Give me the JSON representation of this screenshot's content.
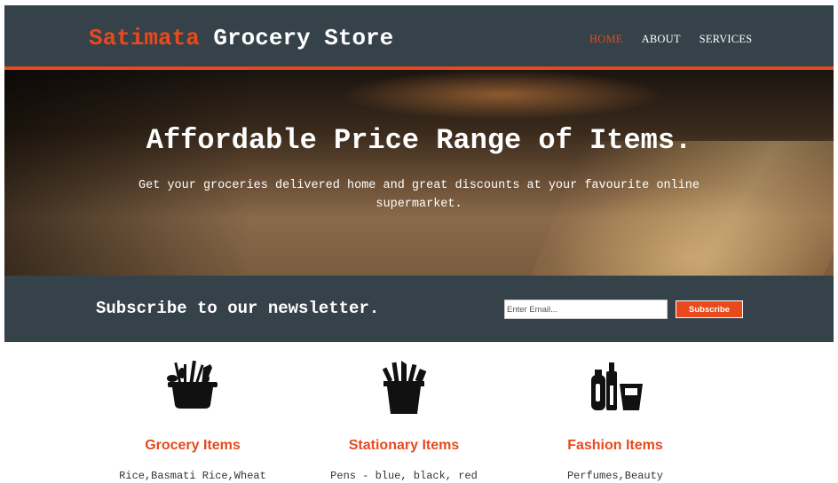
{
  "header": {
    "brand_highlight": "Satimata",
    "brand_rest": " Grocery Store",
    "nav": [
      {
        "label": "HOME"
      },
      {
        "label": "ABOUT"
      },
      {
        "label": "SERVICES"
      }
    ]
  },
  "showcase": {
    "title": "Affordable Price Range of Items.",
    "text": "Get your groceries delivered home and great discounts at your favourite online supermarket."
  },
  "newsletter": {
    "heading": "Subscribe to our newsletter.",
    "placeholder": "Enter Email...",
    "button": "Subscribe"
  },
  "boxes": [
    {
      "icon": "grocery-basket-icon",
      "title": "Grocery Items",
      "text": "Rice,Basmati Rice,Wheat"
    },
    {
      "icon": "stationery-cup-icon",
      "title": "Stationary Items",
      "text": "Pens - blue, black, red"
    },
    {
      "icon": "fashion-bottles-icon",
      "title": "Fashion Items",
      "text": "Perfumes,Beauty"
    }
  ],
  "colors": {
    "accent": "#e8491d",
    "dark": "#35424a"
  }
}
